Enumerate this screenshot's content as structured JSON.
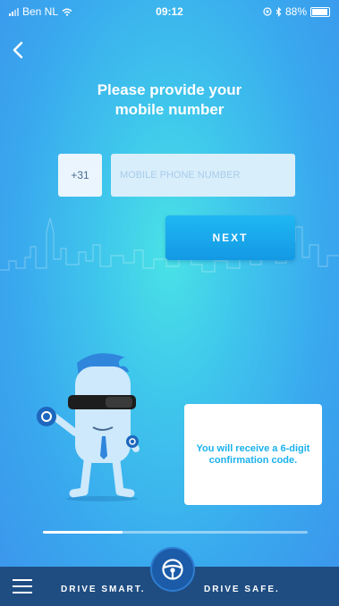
{
  "status_bar": {
    "carrier": "Ben NL",
    "time": "09:12",
    "battery": "88%"
  },
  "title_line1": "Please provide your",
  "title_line2": "mobile number",
  "phone": {
    "country_code": "+31",
    "placeholder": "MOBILE PHONE NUMBER",
    "value": ""
  },
  "next_label": "NEXT",
  "info_message": "You will receive a 6-digit confirmation code.",
  "progress": {
    "fraction": 0.3
  },
  "bottom_bar": {
    "slogan_left": "DRIVE SMART.",
    "slogan_right": "DRIVE SAFE."
  },
  "colors": {
    "accent": "#1ab1ee",
    "bottom_bar": "#1f4d82",
    "card_text": "#1ab1ee"
  },
  "icons": [
    "back-arrow-icon",
    "wifi-icon",
    "steering-wheel-icon",
    "hamburger-menu-icon"
  ]
}
